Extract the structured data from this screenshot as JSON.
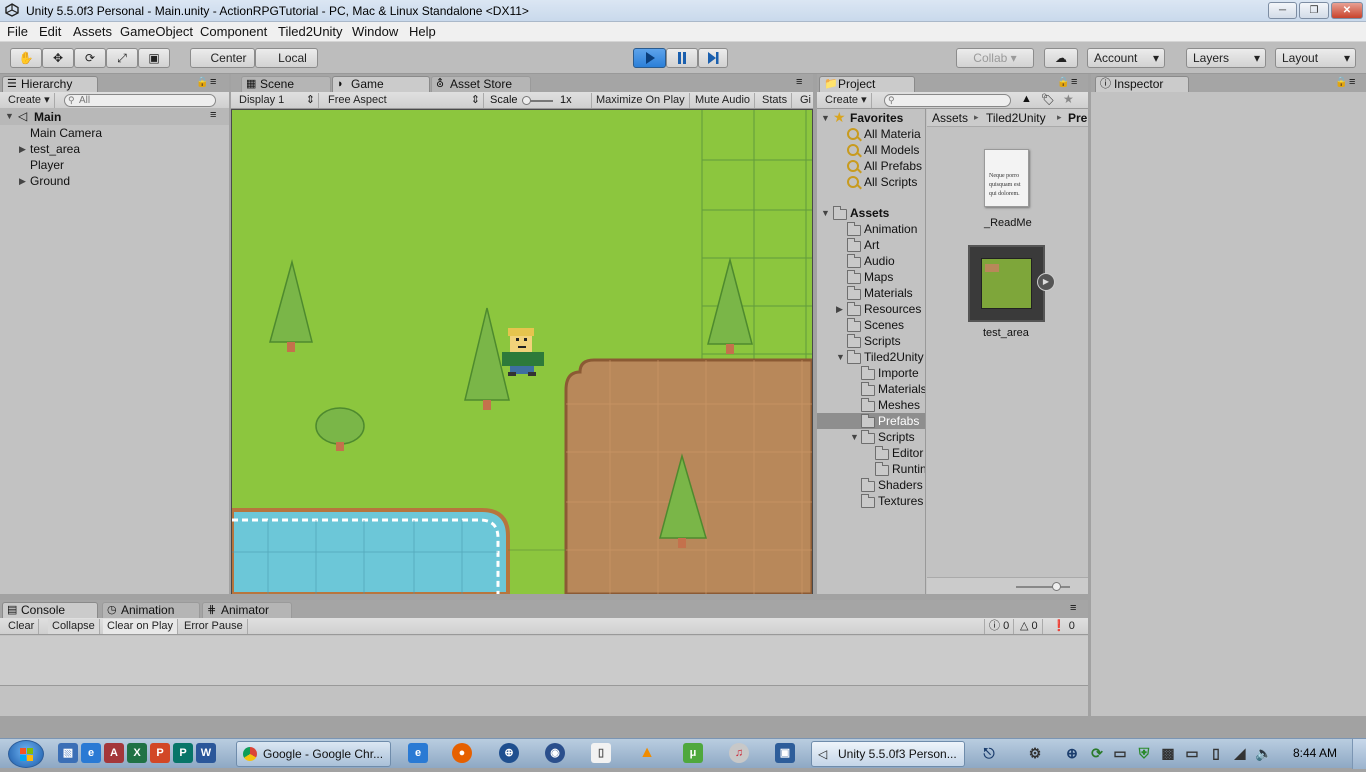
{
  "window": {
    "title": "Unity 5.5.0f3 Personal - Main.unity - ActionRPGTutorial - PC, Mac & Linux Standalone <DX11>",
    "controls": [
      "minimize",
      "maximize",
      "close"
    ]
  },
  "menu": [
    "File",
    "Edit",
    "Assets",
    "GameObject",
    "Component",
    "Tiled2Unity",
    "Window",
    "Help"
  ],
  "toolbar": {
    "pivot": "Center",
    "space": "Local",
    "collab": "Collab",
    "account": "Account",
    "layers": "Layers",
    "layout": "Layout"
  },
  "hierarchy": {
    "tab": "Hierarchy",
    "create": "Create",
    "search_placeholder": "All",
    "scene": "Main",
    "items": [
      "Main Camera",
      "test_area",
      "Player",
      "Ground"
    ]
  },
  "center_tabs": [
    "Scene",
    "Game",
    "Asset Store"
  ],
  "game_bar": {
    "display": "Display 1",
    "aspect": "Free Aspect",
    "scale_label": "Scale",
    "scale_value": "1x",
    "maximize": "Maximize On Play",
    "mute": "Mute Audio",
    "stats": "Stats",
    "gizmos": "Gi"
  },
  "project": {
    "tab": "Project",
    "create": "Create",
    "favorites_label": "Favorites",
    "favorites": [
      "All Materia",
      "All Models",
      "All Prefabs",
      "All Scripts"
    ],
    "assets_label": "Assets",
    "folders": [
      "Animation",
      "Art",
      "Audio",
      "Maps",
      "Materials",
      "Resources",
      "Scenes",
      "Scripts",
      "Tiled2Unity"
    ],
    "tiled_children": [
      "Importe",
      "Materials",
      "Meshes",
      "Prefabs",
      "Scripts"
    ],
    "script_children": [
      "Editor",
      "Runtin"
    ],
    "tiled_more": [
      "Shaders",
      "Textures"
    ],
    "breadcrumb": [
      "Assets",
      "Tiled2Unity",
      "Pre"
    ],
    "files": [
      {
        "name": "_ReadMe",
        "preview_text": "Neque porro quisquam est qui dolorem."
      },
      {
        "name": "test_area"
      }
    ]
  },
  "inspector": {
    "tab": "Inspector"
  },
  "console": {
    "tabs": [
      "Console",
      "Animation",
      "Animator"
    ],
    "buttons": [
      "Clear",
      "Collapse",
      "Clear on Play",
      "Error Pause"
    ],
    "counts": {
      "logs": "0",
      "warnings": "0",
      "errors": "0"
    }
  },
  "taskbar": {
    "chrome_window": "Google - Google Chr...",
    "unity_window": "Unity 5.5.0f3 Person...",
    "clock": "8:44 AM"
  },
  "colors": {
    "grass": "#8cc63e",
    "dirt": "#b8885a",
    "water": "#6cc7d8",
    "tree": "#7ab648",
    "play_active": "#2b7fd8",
    "selected_row": "#8e8e8e"
  }
}
